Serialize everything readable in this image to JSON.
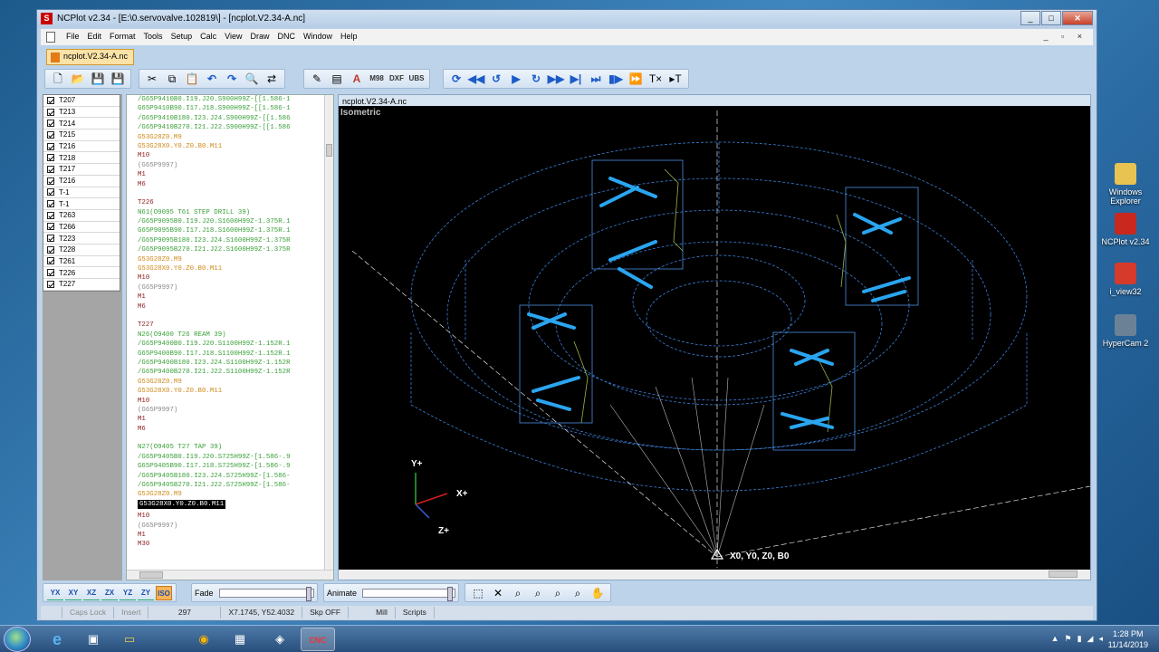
{
  "window": {
    "title": "NCPlot v2.34 - [E:\\0.servovalve.102819\\] - [ncplot.V2.34-A.nc]",
    "controls": [
      "_",
      "□",
      "✕"
    ]
  },
  "menu": {
    "items": [
      "File",
      "Edit",
      "Format",
      "Tools",
      "Setup",
      "Calc",
      "View",
      "Draw",
      "DNC",
      "Window",
      "Help"
    ],
    "mdi_controls": "_ ▫ ×"
  },
  "doc_tab": {
    "label": "ncplot.V2.34-A.nc"
  },
  "toolbar": {
    "file_icons": [
      "new-icon",
      "open-icon",
      "save-icon",
      "save-all-icon"
    ],
    "edit_icons": [
      "cut-icon",
      "copy-icon",
      "paste-icon",
      "undo-icon",
      "redo-icon",
      "find-icon",
      "replace-icon"
    ],
    "text_buttons": [
      "M98",
      "DXF",
      "UBS"
    ],
    "playback_icons": [
      "rewind-icon",
      "step-back-icon",
      "play-icon",
      "loop-icon",
      "step-forward-icon",
      "end-icon",
      "single-step-icon",
      "pause-icon",
      "fast-forward-icon",
      "tx-icon",
      "tx-next-icon"
    ]
  },
  "tools": [
    "T207",
    "T213",
    "T214",
    "T215",
    "T216",
    "T218",
    "T217",
    "T216",
    "T-1",
    "T-1",
    "T263",
    "T266",
    "T223",
    "T228",
    "T261",
    "T226",
    "T227"
  ],
  "code": [
    {
      "t": "/G65P9410B0.I19.J20.S900H99Z-[[1.586-1",
      "c": "#3aa03a"
    },
    {
      "t": "G65P9410B90.I17.J18.S900H99Z-[[1.586-1",
      "c": "#3aa03a"
    },
    {
      "t": "/G65P9410B180.I23.J24.S900H99Z-[[1.586",
      "c": "#3aa03a"
    },
    {
      "t": "/G65P9410B270.I21.J22.S900H99Z-[[1.586",
      "c": "#3aa03a"
    },
    {
      "t": "G53G28Z0.M9",
      "c": "#d08a1a"
    },
    {
      "t": "G53G28X0.Y0.Z0.B0.M11",
      "c": "#d08a1a"
    },
    {
      "t": "M10",
      "c": "#8b1a1a"
    },
    {
      "t": "(G65P9997)",
      "c": "#888888"
    },
    {
      "t": "M1",
      "c": "#8b1a1a"
    },
    {
      "t": "M6",
      "c": "#8b1a1a"
    },
    {
      "t": "",
      "c": "#000"
    },
    {
      "t": "T226",
      "c": "#8b1a1a"
    },
    {
      "t": "N61(O9095 T61 STEP DRILL 39)",
      "c": "#3aa03a"
    },
    {
      "t": "/G65P9095B0.I19.J20.S1600H99Z-1.375R.1",
      "c": "#3aa03a"
    },
    {
      "t": "G65P9095B90.I17.J18.S1600H99Z-1.375R.1",
      "c": "#3aa03a"
    },
    {
      "t": "/G65P9095B180.I23.J24.S1600H99Z-1.375R",
      "c": "#3aa03a"
    },
    {
      "t": "/G65P9095B270.I21.J22.S1600H99Z-1.375R",
      "c": "#3aa03a"
    },
    {
      "t": "G53G28Z0.M9",
      "c": "#d08a1a"
    },
    {
      "t": "G53G28X0.Y0.Z0.B0.M11",
      "c": "#d08a1a"
    },
    {
      "t": "M10",
      "c": "#8b1a1a"
    },
    {
      "t": "(G65P9997)",
      "c": "#888888"
    },
    {
      "t": "M1",
      "c": "#8b1a1a"
    },
    {
      "t": "M6",
      "c": "#8b1a1a"
    },
    {
      "t": "",
      "c": "#000"
    },
    {
      "t": "T227",
      "c": "#8b1a1a"
    },
    {
      "t": "N26(O9400 T26 REAM 39)",
      "c": "#3aa03a"
    },
    {
      "t": "/G65P9400B0.I19.J20.S1100H99Z-1.152R.1",
      "c": "#3aa03a"
    },
    {
      "t": "G65P9400B90.I17.J18.S1100H99Z-1.152R.1",
      "c": "#3aa03a"
    },
    {
      "t": "/G65P9400B180.I23.J24.S1100H99Z-1.152R",
      "c": "#3aa03a"
    },
    {
      "t": "/G65P9400B270.I21.J22.S1100H99Z-1.152R",
      "c": "#3aa03a"
    },
    {
      "t": "G53G28Z0.M9",
      "c": "#d08a1a"
    },
    {
      "t": "G53G28X0.Y0.Z0.B0.M11",
      "c": "#d08a1a"
    },
    {
      "t": "M10",
      "c": "#8b1a1a"
    },
    {
      "t": "(G65P9997)",
      "c": "#888888"
    },
    {
      "t": "M1",
      "c": "#8b1a1a"
    },
    {
      "t": "M6",
      "c": "#8b1a1a"
    },
    {
      "t": "",
      "c": "#000"
    },
    {
      "t": "N27(O9405 T27 TAP 39)",
      "c": "#3aa03a"
    },
    {
      "t": "/G65P9405B0.I19.J20.S725H99Z-[1.586-.9",
      "c": "#3aa03a"
    },
    {
      "t": "G65P9405B90.I17.J18.S725H99Z-[1.586-.9",
      "c": "#3aa03a"
    },
    {
      "t": "/G65P9405B180.I23.J24.S725H99Z-[1.586-",
      "c": "#3aa03a"
    },
    {
      "t": "/G65P9405B270.I21.J22.S725H99Z-[1.586-",
      "c": "#3aa03a"
    },
    {
      "t": "G53G28Z0.M9",
      "c": "#d08a1a"
    },
    {
      "t": "G53G28X0.Y0.Z0.B0.M11",
      "c": "#ffffff",
      "hl": true
    },
    {
      "t": "M10",
      "c": "#8b1a1a"
    },
    {
      "t": "(G65P9997)",
      "c": "#888888"
    },
    {
      "t": "M1",
      "c": "#8b1a1a"
    },
    {
      "t": "M30",
      "c": "#8b1a1a"
    }
  ],
  "plot": {
    "window_title": "ncplot.V2.34-A.nc",
    "view_label": "Isometric",
    "axis_y": "Y+",
    "axis_x": "X+",
    "axis_z": "Z+",
    "origin_label": "X0, Y0, Z0, B0"
  },
  "bottom": {
    "axis_views": [
      "YX",
      "XY",
      "XZ",
      "ZX",
      "YZ",
      "ZY",
      "ISO"
    ],
    "fade_label": "Fade",
    "animate_label": "Animate"
  },
  "status": {
    "caps": "Caps Lock",
    "insert": "Insert",
    "line": "297",
    "coords": "X7.1745, Y52.4032",
    "skip": "Skp OFF",
    "mode": "Mill",
    "scripts": "Scripts"
  },
  "desktop": {
    "icons": [
      {
        "label": "Windows Explorer",
        "color": "#e8c352"
      },
      {
        "label": "NCPlot v2.34",
        "color": "#c8281e"
      },
      {
        "label": "i_view32",
        "color": "#d63a2a"
      },
      {
        "label": "HyperCam 2",
        "color": "#6b8296"
      }
    ]
  },
  "taskbar": {
    "apps": [
      "e",
      "▣",
      "▭",
      "◉",
      "▦",
      "◈",
      "CNC"
    ],
    "time": "1:28 PM",
    "date": "11/14/2019"
  }
}
